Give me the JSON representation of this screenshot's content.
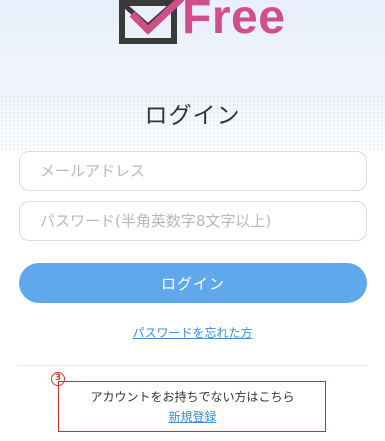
{
  "logo": {
    "text": "Free",
    "icon": "envelope-check-icon"
  },
  "page": {
    "title": "ログイン"
  },
  "form": {
    "email_placeholder": "メールアドレス",
    "email_value": "",
    "password_placeholder": "パスワード(半角英数字8文字以上)",
    "password_value": "",
    "login_label": "ログイン",
    "forgot_label": "パスワードを忘れた方"
  },
  "register": {
    "callout_number": "3",
    "prompt_text": "アカウントをお持ちでない方はこちら",
    "link_label": "新規登録"
  },
  "colors": {
    "brand_pink": "#d24e8a",
    "icon_dark": "#3a3a3a",
    "button_blue": "#60a8ec",
    "link_blue": "#3a8fdc",
    "callout_red": "#c9302c"
  }
}
